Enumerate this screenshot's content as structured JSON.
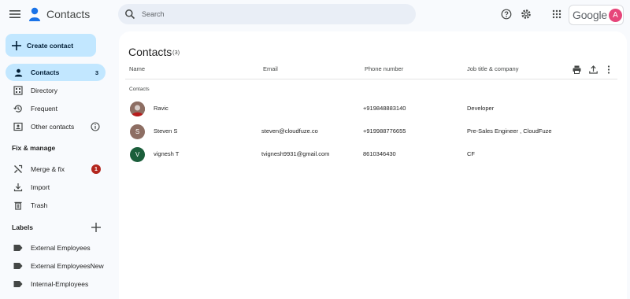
{
  "app": {
    "title": "Contacts"
  },
  "search": {
    "placeholder": "Search"
  },
  "google": {
    "word": "Google",
    "account_initial": "A"
  },
  "sidebar": {
    "create_label": "Create contact",
    "items": [
      {
        "label": "Contacts",
        "icon": "person-icon",
        "count": "3"
      },
      {
        "label": "Directory",
        "icon": "directory-icon"
      },
      {
        "label": "Frequent",
        "icon": "history-icon"
      },
      {
        "label": "Other contacts",
        "icon": "other-contacts-icon"
      }
    ],
    "fix_title": "Fix & manage",
    "fix_items": [
      {
        "label": "Merge & fix",
        "icon": "merge-fix-icon",
        "badge": "1"
      },
      {
        "label": "Import",
        "icon": "import-icon"
      },
      {
        "label": "Trash",
        "icon": "trash-icon"
      }
    ],
    "labels_title": "Labels",
    "labels": [
      {
        "label": "External Employees"
      },
      {
        "label": "External EmployeesNew"
      },
      {
        "label": "Internal-Employees"
      }
    ]
  },
  "main": {
    "title": "Contacts",
    "count": "(3)",
    "columns": {
      "name": "Name",
      "email": "Email",
      "phone": "Phone number",
      "job": "Job title & company"
    },
    "section": "Contacts",
    "rows": [
      {
        "initial": "",
        "name": "Ravic",
        "email": "",
        "phone": "+919848883140",
        "job": "Developer",
        "avatar_color": "#7a5a4e"
      },
      {
        "initial": "S",
        "name": "Steven S",
        "email": "steven@cloudfuze.co",
        "phone": "+919988776655",
        "job": "Pre-Sales Engineer , CloudFuze",
        "avatar_color": "#8d6e63"
      },
      {
        "initial": "V",
        "name": "vignesh T",
        "email": "tvignesh9931@gmail.com",
        "phone": "8610346430",
        "job": "CF",
        "avatar_color": "#1b5e3b"
      }
    ]
  },
  "colors": {
    "accent": "#c2e7ff",
    "badge": "#b3261e",
    "avatar_account": "#e6457a"
  }
}
